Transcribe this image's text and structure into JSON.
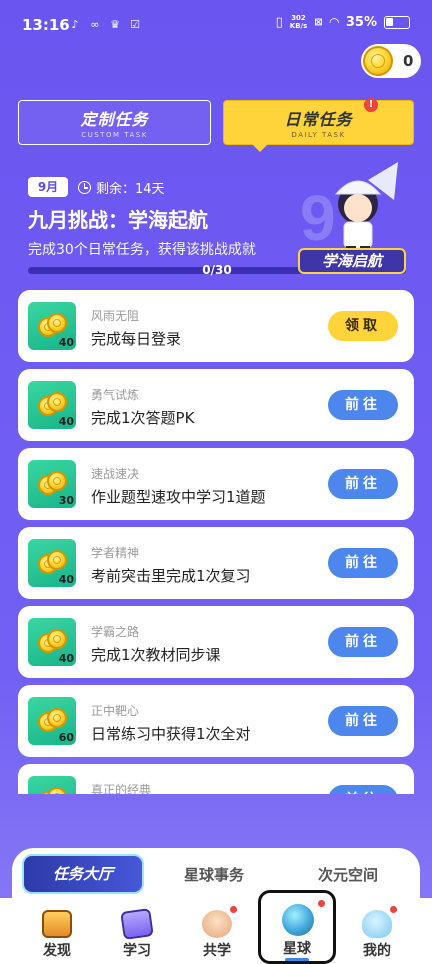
{
  "status_bar": {
    "time": "13:16",
    "net_speed_value": "302",
    "net_speed_unit": "KB/s",
    "battery": "35%"
  },
  "coins": {
    "count": "0"
  },
  "tabs": [
    {
      "label": "定制任务",
      "sub": "CUSTOM TASK",
      "active": false
    },
    {
      "label": "日常任务",
      "sub": "DAILY TASK",
      "active": true,
      "badge": "!"
    }
  ],
  "challenge": {
    "month": "9月",
    "remaining": "剩余：14天",
    "title": "九月挑战：学海起航",
    "description": "完成30个日常任务，获得该挑战成就",
    "progress_text": "0/30",
    "progress_fraction": 0,
    "badge_text": "学海启航"
  },
  "tasks": [
    {
      "category": "风雨无阻",
      "name": "完成每日登录",
      "reward": "40",
      "button": "领取",
      "button_type": "claim"
    },
    {
      "category": "勇气试炼",
      "name": "完成1次答题PK",
      "reward": "40",
      "button": "前往",
      "button_type": "go"
    },
    {
      "category": "速战速决",
      "name": "作业题型速攻中学习1道题",
      "reward": "30",
      "button": "前往",
      "button_type": "go"
    },
    {
      "category": "学者精神",
      "name": "考前突击里完成1次复习",
      "reward": "40",
      "button": "前往",
      "button_type": "go"
    },
    {
      "category": "学霸之路",
      "name": "完成1次教材同步课",
      "reward": "40",
      "button": "前往",
      "button_type": "go"
    },
    {
      "category": "正中靶心",
      "name": "日常练习中获得1次全对",
      "reward": "60",
      "button": "前往",
      "button_type": "go"
    },
    {
      "category": "真正的经典",
      "name": "",
      "reward": "",
      "button": "前往",
      "button_type": "go"
    }
  ],
  "sub_nav": {
    "items": [
      "任务大厅",
      "星球事务",
      "次元空间"
    ],
    "active": "任务大厅"
  },
  "bottom_nav": {
    "items": [
      {
        "label": "发现",
        "icon": "treasure-chest-icon"
      },
      {
        "label": "学习",
        "icon": "book-icon"
      },
      {
        "label": "共学",
        "icon": "study-buddy-icon"
      },
      {
        "label": "星球",
        "icon": "planet-icon",
        "active": true
      },
      {
        "label": "我的",
        "icon": "blob-avatar-icon"
      }
    ]
  },
  "colors": {
    "background": "#6a55f0",
    "accent_yellow": "#ffd43a",
    "button_blue": "#4d87ee",
    "thumb_green": "#2fcc98",
    "alert_red": "#f0433a"
  }
}
